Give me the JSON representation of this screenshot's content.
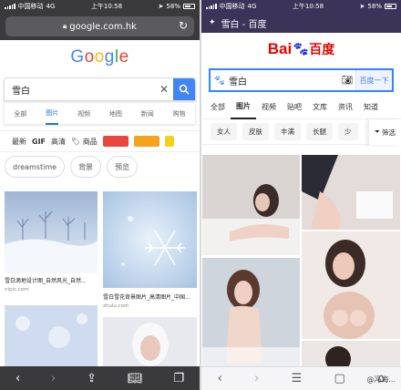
{
  "left": {
    "status": {
      "carrier": "中国移动",
      "network": "4G",
      "time": "上午10:58",
      "battery": "58%"
    },
    "url": "google.com.hk",
    "logo": "Google",
    "search": {
      "query": "雪白"
    },
    "tabs": [
      "全部",
      "图片",
      "视频",
      "地图",
      "新闻",
      "购物"
    ],
    "active_tab": "图片",
    "filters": {
      "latest": "最新",
      "gif": "GIF",
      "hd": "高清",
      "product": "商品"
    },
    "colors": {
      "red": "#e8473f",
      "orange": "#f4a21f",
      "yellow": "#f2d21b"
    },
    "chips": [
      "dreamstime",
      "背景",
      "预览"
    ],
    "results": [
      {
        "caption": "雪白滴地设计图_自然风光_自然...",
        "source": "nipic.com"
      },
      {
        "caption": "雪白雪花背景图片_高清图片_中国...",
        "source": "zhulu.com"
      }
    ]
  },
  "right": {
    "status": {
      "carrier": "中国移动",
      "network": "4G",
      "time": "上午10:58",
      "battery": "58%"
    },
    "title": "雪白 - 百度",
    "logo": {
      "en": "Bai",
      "cn": "百度"
    },
    "search": {
      "query": "雪白",
      "button": "百度一下"
    },
    "tabs": [
      "全部",
      "图片",
      "视频",
      "贴吧",
      "文库",
      "资讯",
      "知道"
    ],
    "active_tab": "图片",
    "filters": [
      "女人",
      "皮肤",
      "丰满",
      "长腿",
      "少"
    ],
    "sift": "筛选",
    "watermark": "@冯海..."
  }
}
